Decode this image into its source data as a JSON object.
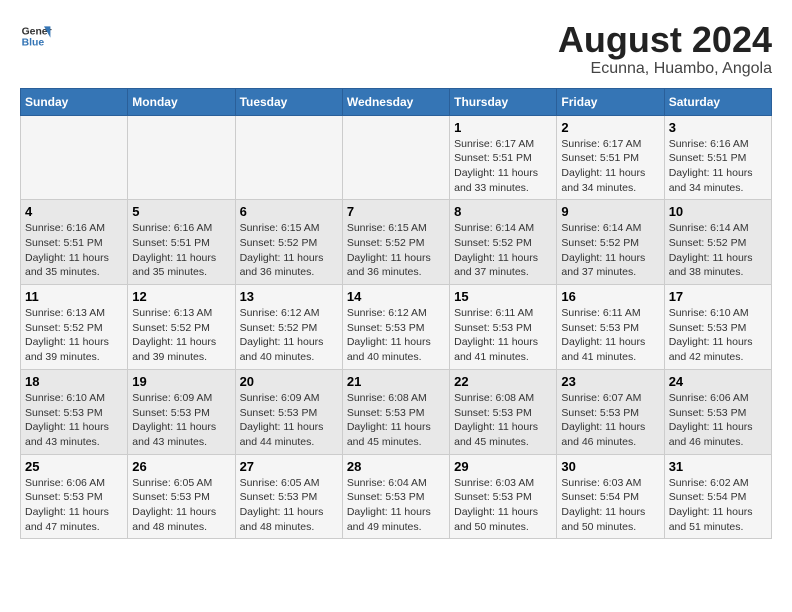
{
  "header": {
    "logo_line1": "General",
    "logo_line2": "Blue",
    "month_year": "August 2024",
    "location": "Ecunna, Huambo, Angola"
  },
  "weekdays": [
    "Sunday",
    "Monday",
    "Tuesday",
    "Wednesday",
    "Thursday",
    "Friday",
    "Saturday"
  ],
  "weeks": [
    [
      {
        "day": "",
        "info": ""
      },
      {
        "day": "",
        "info": ""
      },
      {
        "day": "",
        "info": ""
      },
      {
        "day": "",
        "info": ""
      },
      {
        "day": "1",
        "info": "Sunrise: 6:17 AM\nSunset: 5:51 PM\nDaylight: 11 hours\nand 33 minutes."
      },
      {
        "day": "2",
        "info": "Sunrise: 6:17 AM\nSunset: 5:51 PM\nDaylight: 11 hours\nand 34 minutes."
      },
      {
        "day": "3",
        "info": "Sunrise: 6:16 AM\nSunset: 5:51 PM\nDaylight: 11 hours\nand 34 minutes."
      }
    ],
    [
      {
        "day": "4",
        "info": "Sunrise: 6:16 AM\nSunset: 5:51 PM\nDaylight: 11 hours\nand 35 minutes."
      },
      {
        "day": "5",
        "info": "Sunrise: 6:16 AM\nSunset: 5:51 PM\nDaylight: 11 hours\nand 35 minutes."
      },
      {
        "day": "6",
        "info": "Sunrise: 6:15 AM\nSunset: 5:52 PM\nDaylight: 11 hours\nand 36 minutes."
      },
      {
        "day": "7",
        "info": "Sunrise: 6:15 AM\nSunset: 5:52 PM\nDaylight: 11 hours\nand 36 minutes."
      },
      {
        "day": "8",
        "info": "Sunrise: 6:14 AM\nSunset: 5:52 PM\nDaylight: 11 hours\nand 37 minutes."
      },
      {
        "day": "9",
        "info": "Sunrise: 6:14 AM\nSunset: 5:52 PM\nDaylight: 11 hours\nand 37 minutes."
      },
      {
        "day": "10",
        "info": "Sunrise: 6:14 AM\nSunset: 5:52 PM\nDaylight: 11 hours\nand 38 minutes."
      }
    ],
    [
      {
        "day": "11",
        "info": "Sunrise: 6:13 AM\nSunset: 5:52 PM\nDaylight: 11 hours\nand 39 minutes."
      },
      {
        "day": "12",
        "info": "Sunrise: 6:13 AM\nSunset: 5:52 PM\nDaylight: 11 hours\nand 39 minutes."
      },
      {
        "day": "13",
        "info": "Sunrise: 6:12 AM\nSunset: 5:52 PM\nDaylight: 11 hours\nand 40 minutes."
      },
      {
        "day": "14",
        "info": "Sunrise: 6:12 AM\nSunset: 5:53 PM\nDaylight: 11 hours\nand 40 minutes."
      },
      {
        "day": "15",
        "info": "Sunrise: 6:11 AM\nSunset: 5:53 PM\nDaylight: 11 hours\nand 41 minutes."
      },
      {
        "day": "16",
        "info": "Sunrise: 6:11 AM\nSunset: 5:53 PM\nDaylight: 11 hours\nand 41 minutes."
      },
      {
        "day": "17",
        "info": "Sunrise: 6:10 AM\nSunset: 5:53 PM\nDaylight: 11 hours\nand 42 minutes."
      }
    ],
    [
      {
        "day": "18",
        "info": "Sunrise: 6:10 AM\nSunset: 5:53 PM\nDaylight: 11 hours\nand 43 minutes."
      },
      {
        "day": "19",
        "info": "Sunrise: 6:09 AM\nSunset: 5:53 PM\nDaylight: 11 hours\nand 43 minutes."
      },
      {
        "day": "20",
        "info": "Sunrise: 6:09 AM\nSunset: 5:53 PM\nDaylight: 11 hours\nand 44 minutes."
      },
      {
        "day": "21",
        "info": "Sunrise: 6:08 AM\nSunset: 5:53 PM\nDaylight: 11 hours\nand 45 minutes."
      },
      {
        "day": "22",
        "info": "Sunrise: 6:08 AM\nSunset: 5:53 PM\nDaylight: 11 hours\nand 45 minutes."
      },
      {
        "day": "23",
        "info": "Sunrise: 6:07 AM\nSunset: 5:53 PM\nDaylight: 11 hours\nand 46 minutes."
      },
      {
        "day": "24",
        "info": "Sunrise: 6:06 AM\nSunset: 5:53 PM\nDaylight: 11 hours\nand 46 minutes."
      }
    ],
    [
      {
        "day": "25",
        "info": "Sunrise: 6:06 AM\nSunset: 5:53 PM\nDaylight: 11 hours\nand 47 minutes."
      },
      {
        "day": "26",
        "info": "Sunrise: 6:05 AM\nSunset: 5:53 PM\nDaylight: 11 hours\nand 48 minutes."
      },
      {
        "day": "27",
        "info": "Sunrise: 6:05 AM\nSunset: 5:53 PM\nDaylight: 11 hours\nand 48 minutes."
      },
      {
        "day": "28",
        "info": "Sunrise: 6:04 AM\nSunset: 5:53 PM\nDaylight: 11 hours\nand 49 minutes."
      },
      {
        "day": "29",
        "info": "Sunrise: 6:03 AM\nSunset: 5:53 PM\nDaylight: 11 hours\nand 50 minutes."
      },
      {
        "day": "30",
        "info": "Sunrise: 6:03 AM\nSunset: 5:54 PM\nDaylight: 11 hours\nand 50 minutes."
      },
      {
        "day": "31",
        "info": "Sunrise: 6:02 AM\nSunset: 5:54 PM\nDaylight: 11 hours\nand 51 minutes."
      }
    ]
  ]
}
